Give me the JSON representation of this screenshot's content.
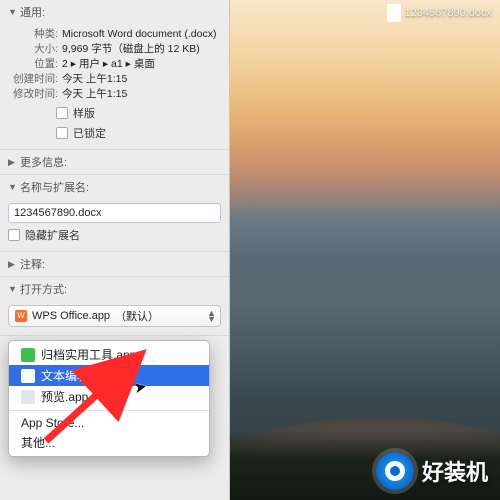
{
  "desktop": {
    "file_label": "1234567890.docx"
  },
  "panel": {
    "general": {
      "title": "通用:",
      "kind_label": "种类:",
      "kind_value": "Microsoft Word document (.docx)",
      "size_label": "大小:",
      "size_value": "9,969 字节（磁盘上的 12 KB)",
      "where_label": "位置:",
      "where_value": "2 ▸ 用户 ▸ a1 ▸ 桌面",
      "created_label": "创建时间:",
      "created_value": "今天 上午1:15",
      "modified_label": "修改时间:",
      "modified_value": "今天 上午1:15",
      "stationery": "样版",
      "locked": "已锁定"
    },
    "more_info": "更多信息:",
    "name_ext": {
      "title": "名称与扩展名:",
      "value": "1234567890.docx",
      "hide_ext": "隐藏扩展名"
    },
    "comments": "注释:",
    "open_with": {
      "title": "打开方式:",
      "selected": "WPS Office.app",
      "default_suffix": "（默认）"
    }
  },
  "menu": {
    "items": [
      "归档实用工具.app",
      "文本编辑.app",
      "预览.app"
    ],
    "app_store": "App Store...",
    "other": "其他..."
  },
  "watermark": "好装机"
}
